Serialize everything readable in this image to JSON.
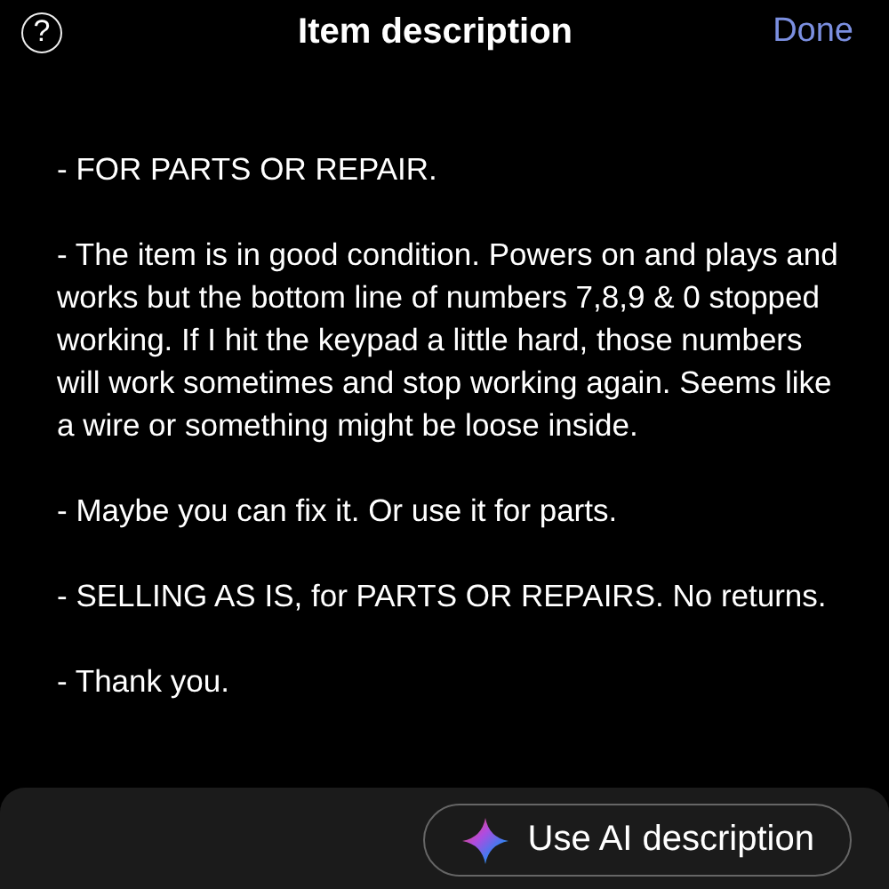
{
  "header": {
    "help_icon": "?",
    "title": "Item description",
    "done": "Done"
  },
  "description": {
    "paragraphs": [
      "- FOR PARTS OR REPAIR.",
      "- The item is in good condition. Powers on and plays and works but the bottom line of numbers 7,8,9 & 0 stopped working. If I hit the keypad a little hard, those numbers will work sometimes and stop working again. Seems like a wire or something might be loose inside.",
      "- Maybe you can fix it. Or use it for parts.",
      "- SELLING AS IS, for PARTS OR REPAIRS. No returns.",
      "- Thank you."
    ]
  },
  "ai_button": {
    "label": "Use AI description"
  }
}
